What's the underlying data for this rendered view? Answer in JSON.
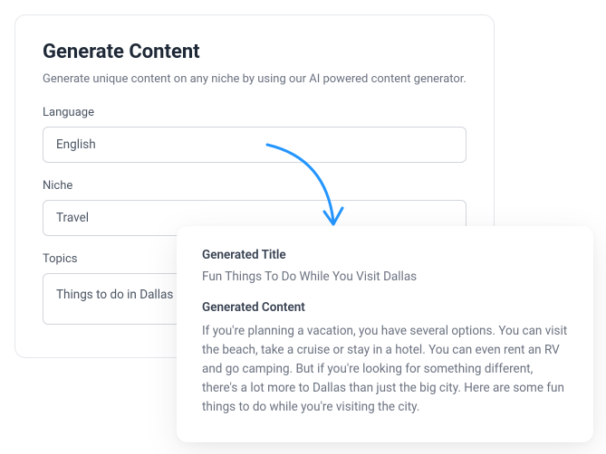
{
  "form": {
    "title": "Generate Content",
    "description": "Generate unique content on any niche by using our AI powered content generator.",
    "fields": {
      "language": {
        "label": "Language",
        "value": "English"
      },
      "niche": {
        "label": "Niche",
        "value": "Travel"
      },
      "topics": {
        "label": "Topics",
        "value": "Things to do in Dallas "
      }
    }
  },
  "result": {
    "title_label": "Generated Title",
    "title_value": "Fun Things To Do While You Visit Dallas",
    "content_label": "Generated Content",
    "content_value": "If you're planning a vacation, you have several options. You can visit the beach, take a cruise or stay in a hotel. You can even rent an RV and go camping. But if you're looking for something different, there's a lot more to Dallas than just the big city. Here are some fun things to do while you're visiting the city."
  }
}
